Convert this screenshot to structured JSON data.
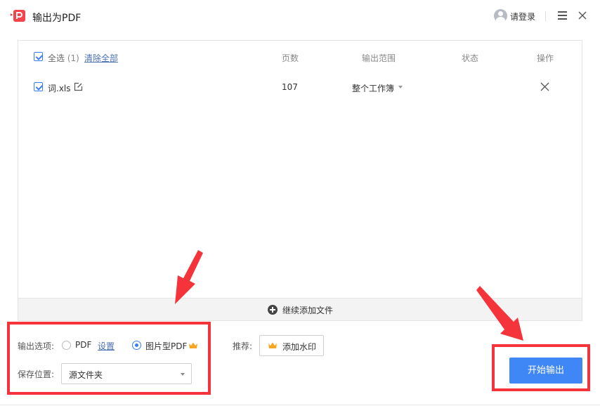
{
  "window": {
    "title": "输出为PDF",
    "login_label": "请登录"
  },
  "table": {
    "select_all_label": "全选",
    "select_all_count": "(1)",
    "clear_all_label": "清除全部",
    "headers": {
      "pages": "页数",
      "range": "输出范围",
      "status": "状态",
      "actions": "操作"
    },
    "rows": [
      {
        "checked": true,
        "filename": "词.xls",
        "pages": "107",
        "range": "整个工作簿",
        "status": ""
      }
    ]
  },
  "add_more_label": "继续添加文件",
  "options": {
    "output_label": "输出选项:",
    "pdf_label": "PDF",
    "settings_label": "设置",
    "image_pdf_label": "图片型PDF",
    "selected": "image_pdf",
    "save_label": "保存位置:",
    "save_value": "源文件夹"
  },
  "recommend": {
    "label": "推荐:",
    "watermark_label": "添加水印"
  },
  "start_label": "开始输出",
  "colors": {
    "accent": "#3f86f7",
    "annotation": "#f5333b",
    "crown": "#f5a623"
  },
  "icons": [
    "app-pdf-icon",
    "avatar-icon",
    "menu-icon",
    "close-icon",
    "edit-icon",
    "plus-circle-icon",
    "crown-icon"
  ]
}
